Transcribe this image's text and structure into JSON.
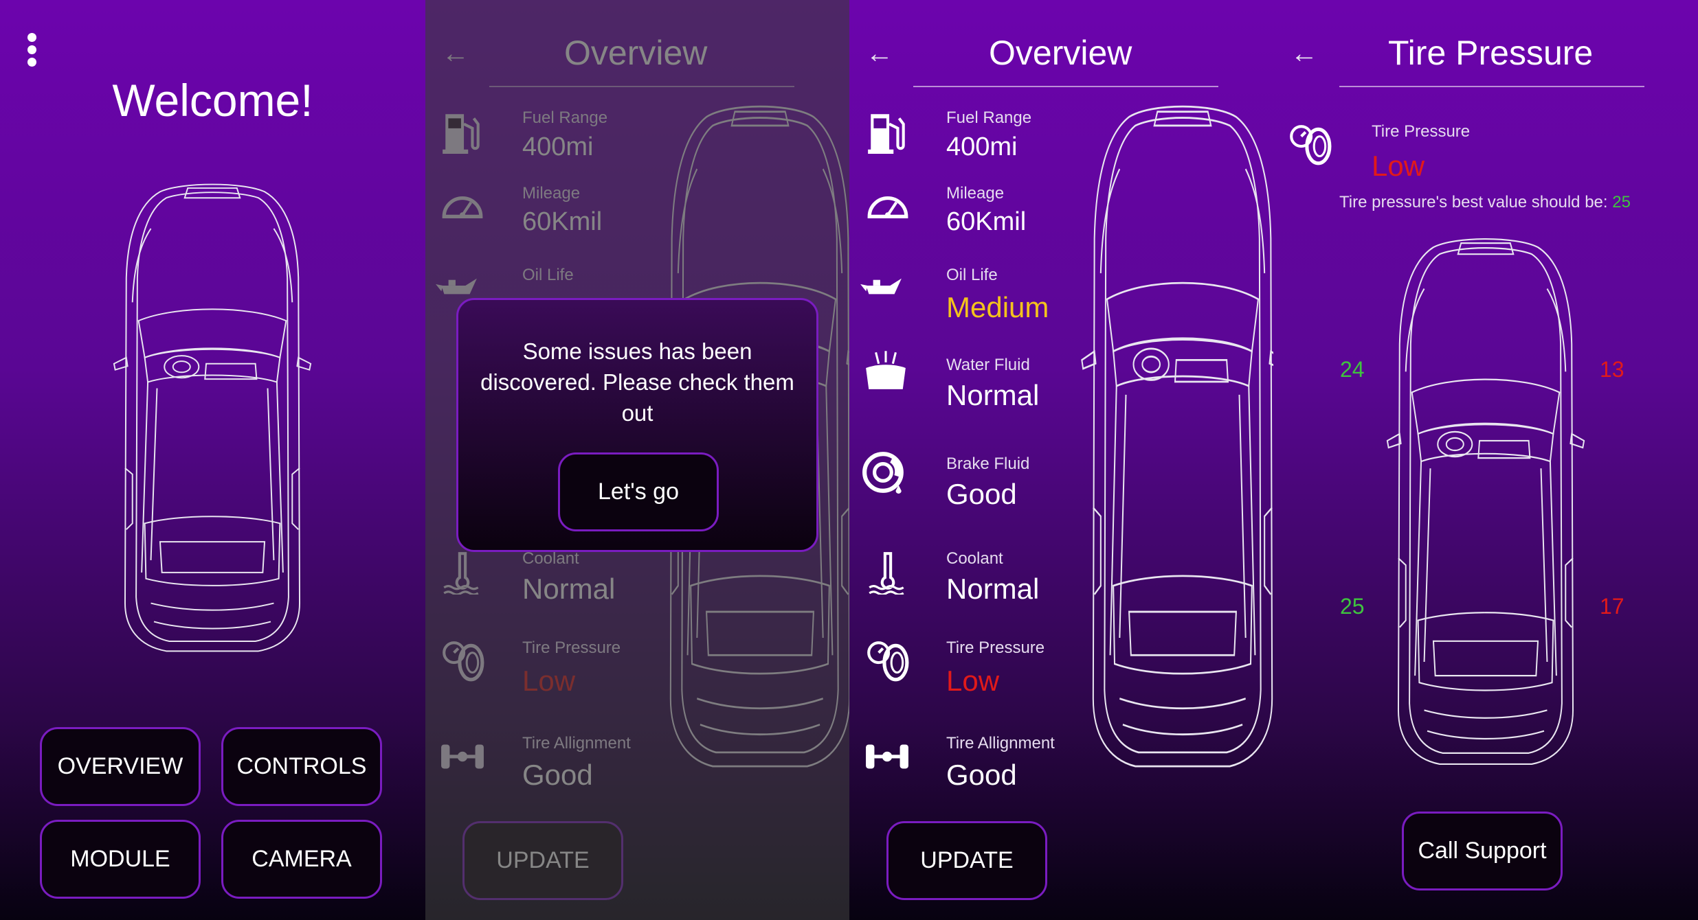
{
  "colors": {
    "accent_border": "#7a1cc0",
    "low": "#e11a1a",
    "medium": "#f4c31c",
    "good_green": "#3fc43f",
    "warn_red": "#e11a1a"
  },
  "home": {
    "title": "Welcome!",
    "buttons": [
      "OVERVIEW",
      "CONTROLS",
      "MODULE",
      "CAMERA"
    ]
  },
  "overview": {
    "title": "Overview",
    "items": [
      {
        "label": "Fuel Range",
        "value": "400mi",
        "icon": "fuel-pump-icon",
        "status": "normal"
      },
      {
        "label": "Mileage",
        "value": "60Kmil",
        "icon": "speedometer-icon",
        "status": "normal"
      },
      {
        "label": "Oil Life",
        "value": "Medium",
        "icon": "oil-can-icon",
        "status": "medium"
      },
      {
        "label": "Water Fluid",
        "value": "Normal",
        "icon": "washer-fluid-icon",
        "status": "normal"
      },
      {
        "label": "Brake Fluid",
        "value": "Good",
        "icon": "brake-icon",
        "status": "normal"
      },
      {
        "label": "Coolant",
        "value": "Normal",
        "icon": "thermometer-icon",
        "status": "normal"
      },
      {
        "label": "Tire Pressure",
        "value": "Low",
        "icon": "tire-gauge-icon",
        "status": "low"
      },
      {
        "label": "Tire Allignment",
        "value": "Good",
        "icon": "axle-icon",
        "status": "normal"
      }
    ],
    "update_label": "UPDATE",
    "dialog": {
      "message": "Some issues has been discovered. Please check them out",
      "button": "Let's go"
    }
  },
  "tire": {
    "title": "Tire Pressure",
    "label": "Tire Pressure",
    "value": "Low",
    "best_text": "Tire pressure's best value should be: ",
    "best_value": "25",
    "front_left": "24",
    "front_right": "13",
    "rear_left": "25",
    "rear_right": "17",
    "support_label": "Call Support"
  }
}
